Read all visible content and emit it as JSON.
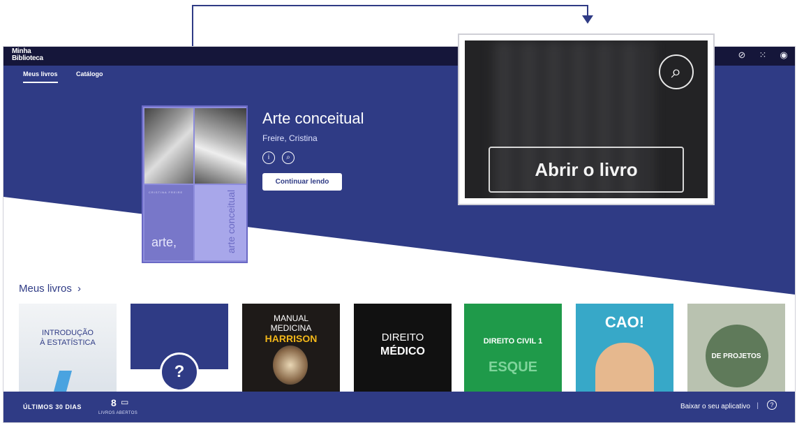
{
  "header": {
    "logo_line1": "Minha",
    "logo_line2": "Biblioteca",
    "icons": [
      "no-camera-icon",
      "apps-grid-icon",
      "account-icon"
    ]
  },
  "tabs": [
    {
      "label": "Meus livros",
      "active": true
    },
    {
      "label": "Catálogo",
      "active": false
    }
  ],
  "featured_book": {
    "title": "Arte conceitual",
    "author": "Freire, Cristina",
    "continue_label": "Continuar lendo",
    "cover_vertical_title": "arte conceitual",
    "cover_brand": "arte,"
  },
  "section": {
    "title": "Meus livros",
    "chevron": "›"
  },
  "shelf_books": [
    {
      "line1": "INTRODUÇÃO",
      "line2": "À ESTATÍSTICA"
    },
    {
      "line1": "?",
      "line2": ""
    },
    {
      "line1": "MANUAL",
      "line2": "MEDICINA",
      "line3": "HARRISON"
    },
    {
      "line1": "DIREITO",
      "line2": "MÉDICO"
    },
    {
      "line1": "DIREITO CIVIL 1",
      "line2": "ESQUE"
    },
    {
      "line1": "CAO!",
      "line2": ""
    },
    {
      "line1": "DE PROJETOS",
      "line2": ""
    }
  ],
  "footer": {
    "days_label": "ÚLTIMOS 30 DIAS",
    "books_count": "8",
    "books_label": "LIVROS ABERTOS",
    "app_link": "Baixar o seu aplicativo",
    "separator": "|",
    "help": "?"
  },
  "zoom_callout": {
    "open_book_label": "Abrir o livro"
  },
  "colors": {
    "primary": "#2f3b85",
    "topbar": "#15163a",
    "callout_line": "#2f3b85"
  }
}
